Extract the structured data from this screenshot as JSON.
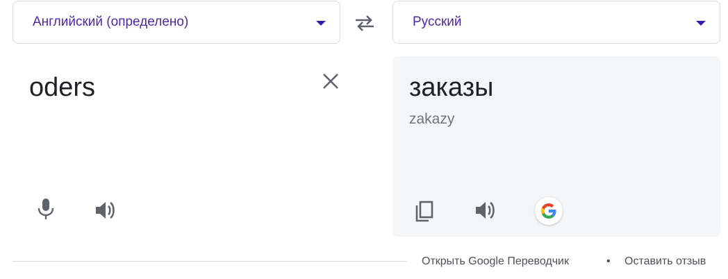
{
  "source_language": {
    "label": "Английский (определено)",
    "caret_icon": "chevron-down-icon"
  },
  "target_language": {
    "label": "Русский",
    "caret_icon": "chevron-down-icon"
  },
  "swap_icon": "swap-arrows-icon",
  "source_panel": {
    "text": "oders",
    "clear_icon": "close-icon",
    "mic_icon": "microphone-icon",
    "listen_icon": "speaker-icon"
  },
  "target_panel": {
    "translation": "заказы",
    "transliteration": "zakazy",
    "copy_icon": "copy-icon",
    "listen_icon": "speaker-icon",
    "google_icon": "google-logo-icon"
  },
  "footer": {
    "open_link": "Открыть Google Переводчик",
    "separator": "•",
    "feedback_link": "Оставить отзыв"
  },
  "colors": {
    "language_text": "#4a2a9c",
    "caret": "#3c1aa8",
    "target_panel_bg": "#f5f6f8",
    "icon_gray": "#5f6368"
  }
}
